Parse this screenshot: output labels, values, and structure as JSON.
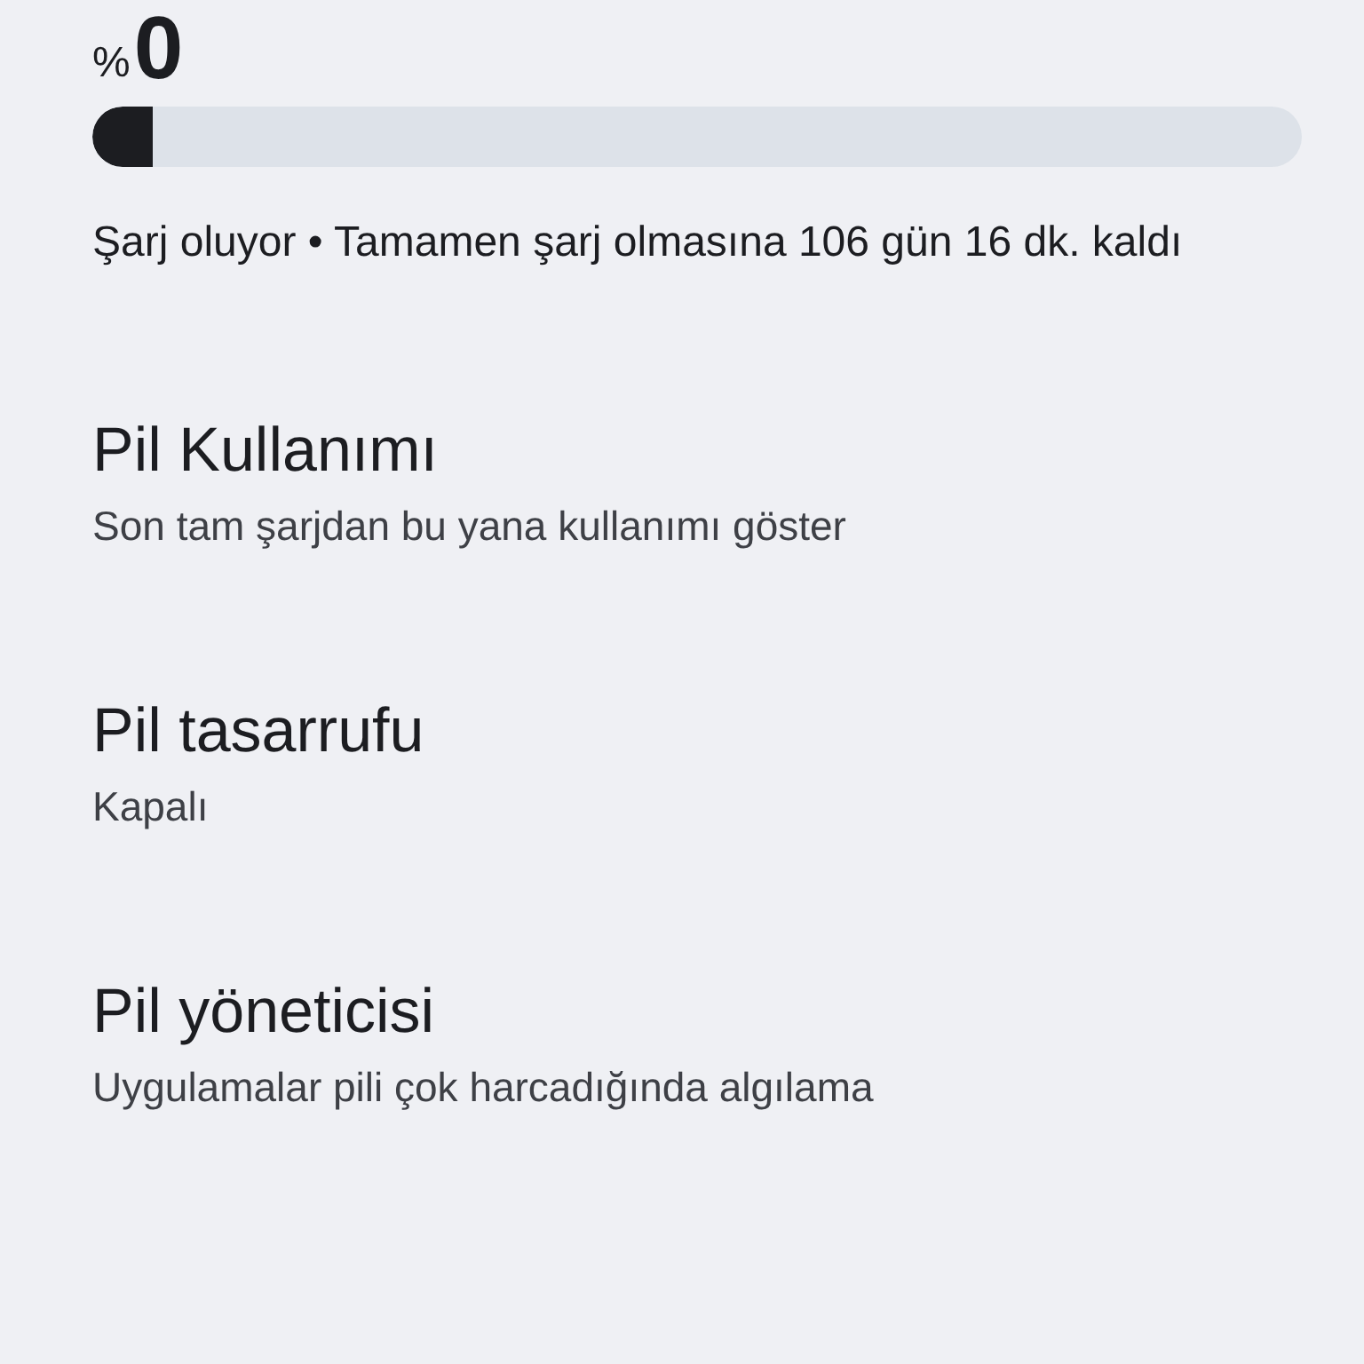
{
  "battery": {
    "percent_sign": "%",
    "value": "0",
    "level": 0.05,
    "status": "Şarj oluyor • Tamamen şarj olmasına 106 gün 16 dk. kaldı"
  },
  "items": [
    {
      "title": "Pil Kullanımı",
      "summary": "Son tam şarjdan bu yana kullanımı göster"
    },
    {
      "title": "Pil tasarrufu",
      "summary": "Kapalı"
    },
    {
      "title": "Pil yöneticisi",
      "summary": "Uygulamalar pili çok harcadığında algılama"
    }
  ]
}
